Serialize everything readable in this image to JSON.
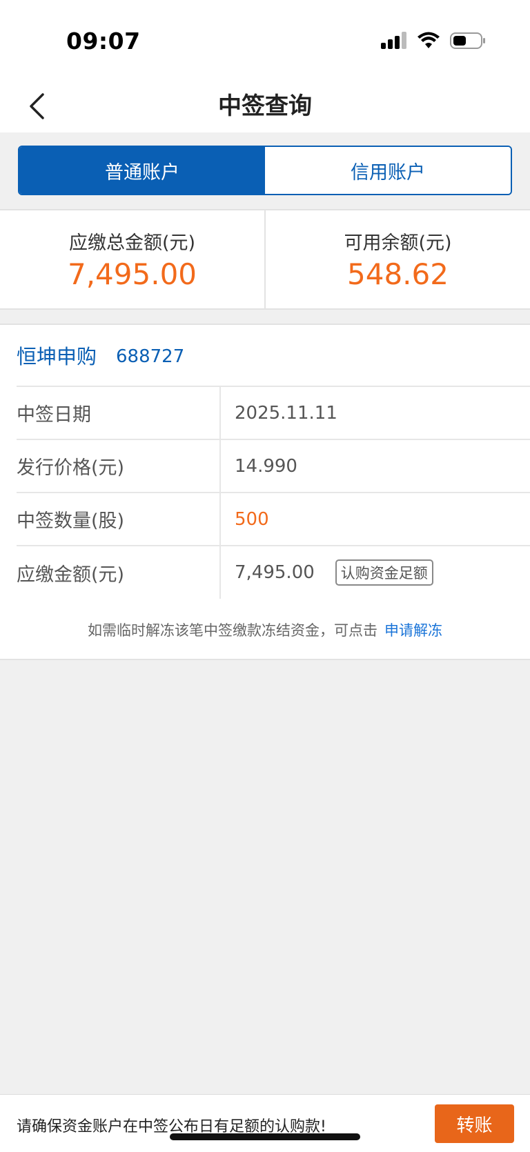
{
  "status_bar": {
    "time": "09:07"
  },
  "nav": {
    "title": "中签查询"
  },
  "tabs": [
    {
      "label": "普通账户",
      "active": true
    },
    {
      "label": "信用账户",
      "active": false
    }
  ],
  "summary": {
    "total_due_label": "应缴总金额(元)",
    "total_due_value": "7,495.00",
    "available_label": "可用余额(元)",
    "available_value": "548.62"
  },
  "stock": {
    "name": "恒坤申购",
    "code": "688727",
    "rows": [
      {
        "label": "中签日期",
        "value": "2025.11.11"
      },
      {
        "label": "发行价格(元)",
        "value": "14.990"
      },
      {
        "label": "中签数量(股)",
        "value": "500"
      },
      {
        "label": "应缴金额(元)",
        "value": "7,495.00",
        "badge": "认购资金足额"
      }
    ]
  },
  "notice": {
    "text": "如需临时解冻该笔中签缴款冻结资金，可点击",
    "link": "申请解冻"
  },
  "bottom": {
    "text": "请确保资金账户在中签公布日有足额的认购款!",
    "button": "转账"
  },
  "colors": {
    "primary_blue": "#0a5fb4",
    "accent_orange": "#f26a1b",
    "link_blue": "#1a74d8"
  }
}
